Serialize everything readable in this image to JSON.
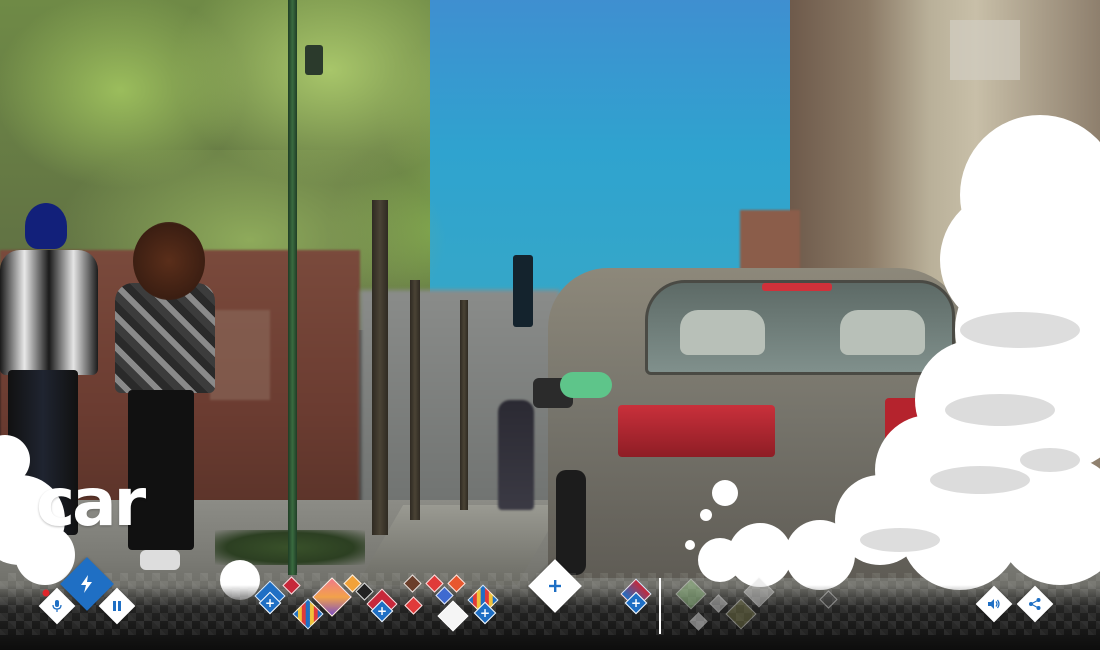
{
  "brand": {
    "wordmark": "car"
  },
  "controls": {
    "mic_icon": "microphone-icon",
    "bolt_icon": "lightning-bolt-icon",
    "pause_icon": "pause-icon",
    "add_icon": "plus-icon",
    "volume_icon": "speaker-volume-icon",
    "share_icon": "share-icon",
    "plus_symbol": "+"
  },
  "colors": {
    "accent_blue": "#1f6fc4",
    "record_red": "#e0262c",
    "button_white": "#ffffff",
    "bar_dark": "#0d0d0d"
  }
}
